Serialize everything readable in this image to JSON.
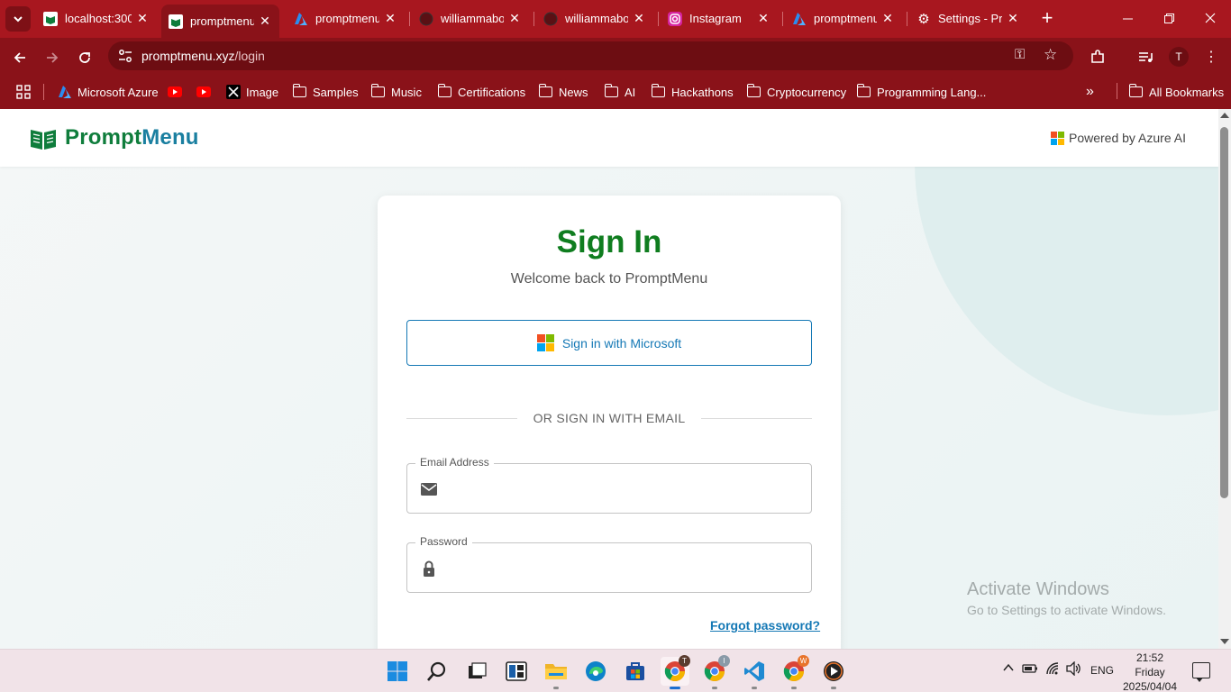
{
  "browser": {
    "tabs": [
      {
        "title": "localhost:300",
        "icon": "promptmenu-favicon"
      },
      {
        "title": "promptmenu",
        "icon": "promptmenu-favicon",
        "active": true
      },
      {
        "title": "promptmenu",
        "icon": "azure-icon"
      },
      {
        "title": "williammabo",
        "icon": "github-icon"
      },
      {
        "title": "williammabo",
        "icon": "github-icon"
      },
      {
        "title": "Instagram",
        "icon": "instagram-icon"
      },
      {
        "title": "promptmenu",
        "icon": "azure-icon"
      },
      {
        "title": "Settings - Pri",
        "icon": "gear-icon"
      }
    ],
    "url_host": "promptmenu.xyz",
    "url_path": "/login",
    "profile_initial": "T",
    "bookmarks": [
      {
        "label": "Microsoft Azure",
        "icon": "azure-icon"
      },
      {
        "label": "",
        "icon": "youtube-icon"
      },
      {
        "label": "",
        "icon": "youtube-icon"
      },
      {
        "label": "Image",
        "icon": "x-icon"
      },
      {
        "label": "Samples",
        "icon": "folder-icon"
      },
      {
        "label": "Music",
        "icon": "folder-icon"
      },
      {
        "label": "Certifications",
        "icon": "folder-icon"
      },
      {
        "label": "News",
        "icon": "folder-icon"
      },
      {
        "label": "AI",
        "icon": "folder-icon"
      },
      {
        "label": "Hackathons",
        "icon": "folder-icon"
      },
      {
        "label": "Cryptocurrency",
        "icon": "folder-icon"
      },
      {
        "label": "Programming Lang...",
        "icon": "folder-icon"
      }
    ],
    "overflow_label": "»",
    "all_bookmarks": "All Bookmarks",
    "colors": {
      "chrome_bg": "#a8171f",
      "toolbar_bg": "#8a1219"
    }
  },
  "header": {
    "brand_prompt": "Prompt",
    "brand_menu": "Menu",
    "powered_by": "Powered by Azure AI"
  },
  "login": {
    "title": "Sign In",
    "subtitle": "Welcome back to PromptMenu",
    "microsoft_button": "Sign in with Microsoft",
    "divider": "OR SIGN IN WITH EMAIL",
    "email_label": "Email Address",
    "email_value": "",
    "password_label": "Password",
    "password_value": "",
    "forgot": "Forgot password?",
    "colors": {
      "title": "#0f7d1f",
      "link": "#1478b5"
    }
  },
  "watermark": {
    "line1": "Activate Windows",
    "line2": "Go to Settings to activate Windows."
  },
  "taskbar": {
    "apps": [
      "windows-start-icon",
      "search-icon",
      "task-view-icon",
      "widgets-icon",
      "file-explorer-icon",
      "edge-icon",
      "store-icon",
      "chrome-icon",
      "chrome-icon",
      "vscode-icon",
      "chrome-icon",
      "media-player-icon"
    ],
    "language": "ENG",
    "time": "21:52",
    "day": "Friday",
    "date": "2025/04/04"
  }
}
